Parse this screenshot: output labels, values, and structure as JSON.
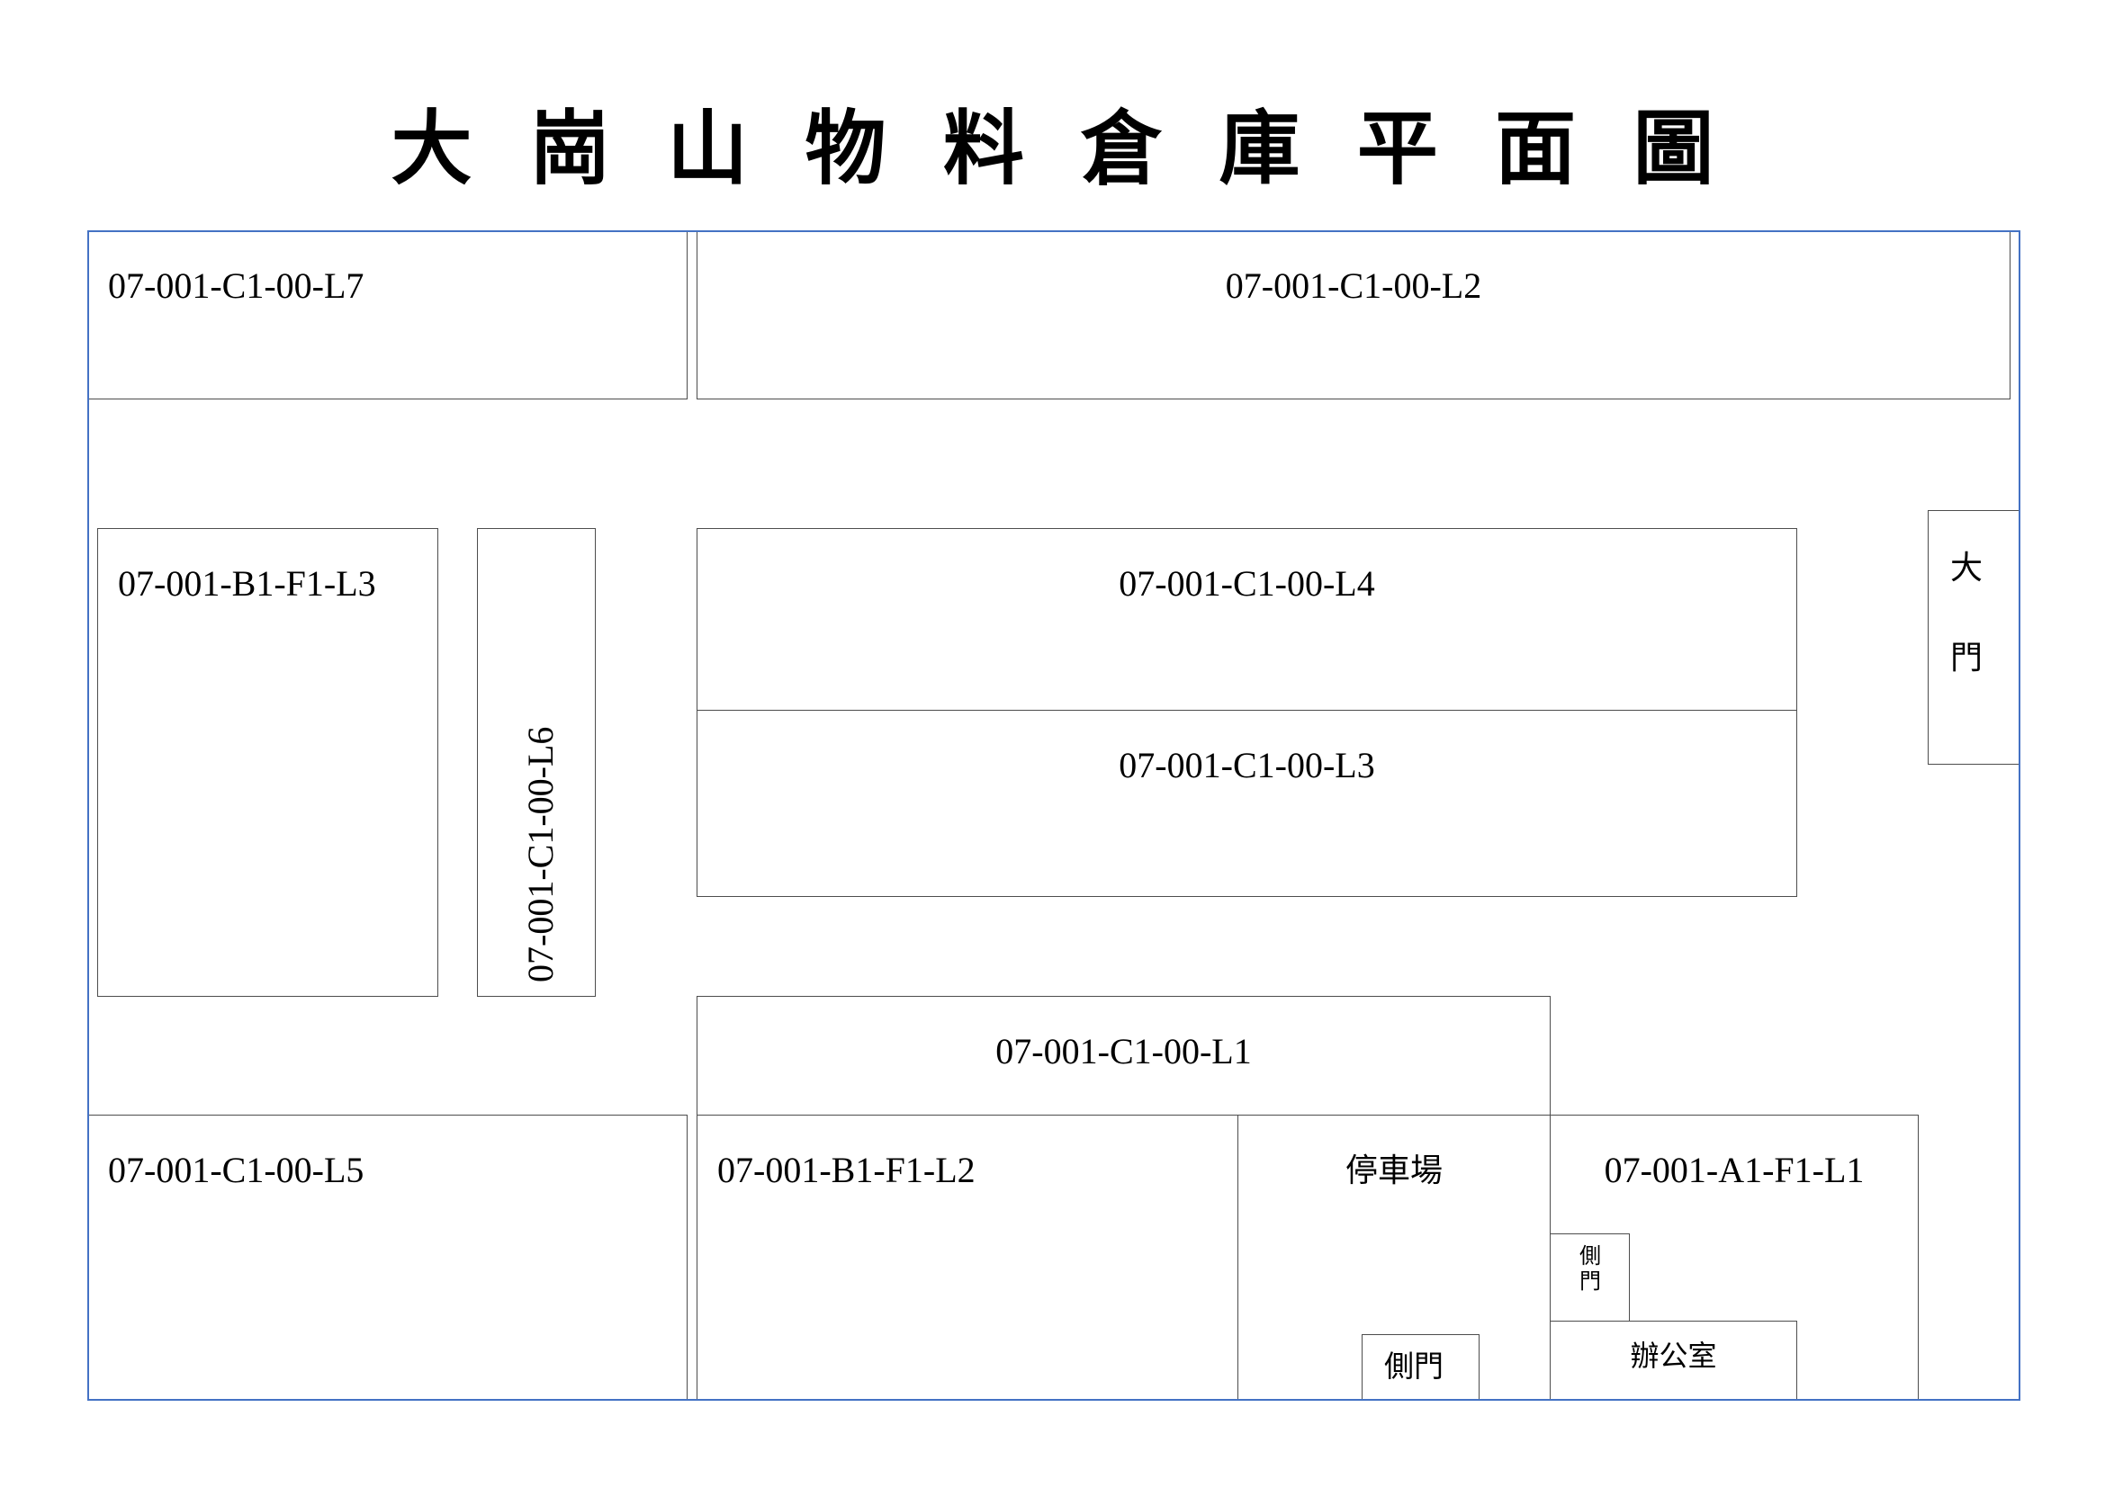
{
  "title": "大 崗 山 物 料 倉 庫 平 面 圖",
  "storage_zones": {
    "c1_00_l7": "07-001-C1-00-L7",
    "c1_00_l2": "07-001-C1-00-L2",
    "b1_f1_l3": "07-001-B1-F1-L3",
    "c1_00_l6": "07-001-C1-00-L6",
    "c1_00_l4": "07-001-C1-00-L4",
    "c1_00_l3": "07-001-C1-00-L3",
    "c1_00_l1": "07-001-C1-00-L1",
    "c1_00_l5": "07-001-C1-00-L5",
    "b1_f1_l2": "07-001-B1-F1-L2",
    "a1_f1_l1": "07-001-A1-F1-L1"
  },
  "facilities": {
    "main_gate": "大門",
    "parking": "停車場",
    "side_gate_parking": "側門",
    "side_gate_office": "側門",
    "office": "辦公室"
  },
  "colors": {
    "site_boundary": "#4472c4",
    "zone_outline": "#4d4d4d",
    "text": "#000000"
  }
}
